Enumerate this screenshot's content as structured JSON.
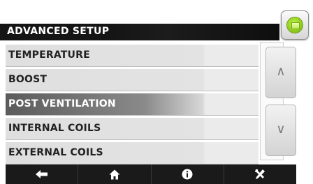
{
  "header": {
    "title": "ADVANCED SETUP"
  },
  "status_indicator": {
    "icon": "device-status-icon",
    "color": "#8ccd1e"
  },
  "menu": {
    "items": [
      {
        "label": "TEMPERATURE"
      },
      {
        "label": "BOOST"
      },
      {
        "label": "POST VENTILATION",
        "selected": true
      },
      {
        "label": "INTERNAL COILS"
      },
      {
        "label": "EXTERNAL COILS"
      }
    ]
  },
  "scroll": {
    "up_glyph": "∧",
    "down_glyph": "∨"
  },
  "navbar": {
    "buttons": [
      {
        "icon": "back-arrow-icon"
      },
      {
        "icon": "home-icon"
      },
      {
        "icon": "info-icon"
      },
      {
        "icon": "tools-icon"
      }
    ]
  },
  "colors": {
    "title_bar": "#151515",
    "active_row": "#5b5b5b",
    "led": "#8ccd1e"
  }
}
